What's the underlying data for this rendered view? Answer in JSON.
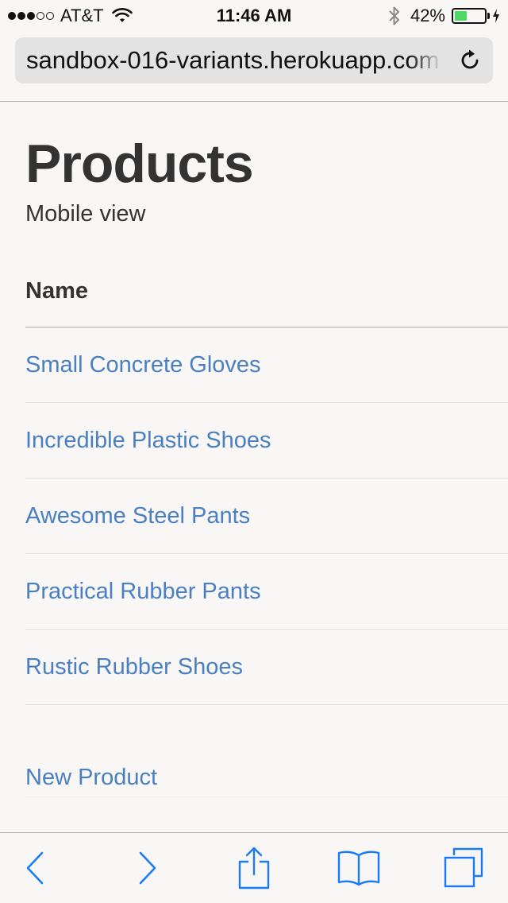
{
  "status_bar": {
    "carrier": "AT&T",
    "signal_bars_filled": 3,
    "signal_bars_total": 5,
    "time": "11:46 AM",
    "battery_percent": "42%",
    "battery_level": 0.42,
    "icons": [
      "wifi-icon",
      "bluetooth-icon",
      "battery-icon",
      "charging-icon"
    ]
  },
  "browser": {
    "url": "sandbox-016-variants.herokuapp.com",
    "reload_icon": "reload-icon"
  },
  "page": {
    "title": "Products",
    "subtitle": "Mobile view",
    "table": {
      "header": "Name",
      "rows": [
        "Small Concrete Gloves",
        "Incredible Plastic Shoes",
        "Awesome Steel Pants",
        "Practical Rubber Pants",
        "Rustic Rubber Shoes"
      ]
    },
    "new_product_link": "New Product",
    "link_color": "#4a7fc1"
  },
  "toolbar": {
    "icons": [
      "back-icon",
      "forward-icon",
      "share-icon",
      "bookmarks-icon",
      "tabs-icon"
    ],
    "accent_color": "#1a7cf5"
  }
}
